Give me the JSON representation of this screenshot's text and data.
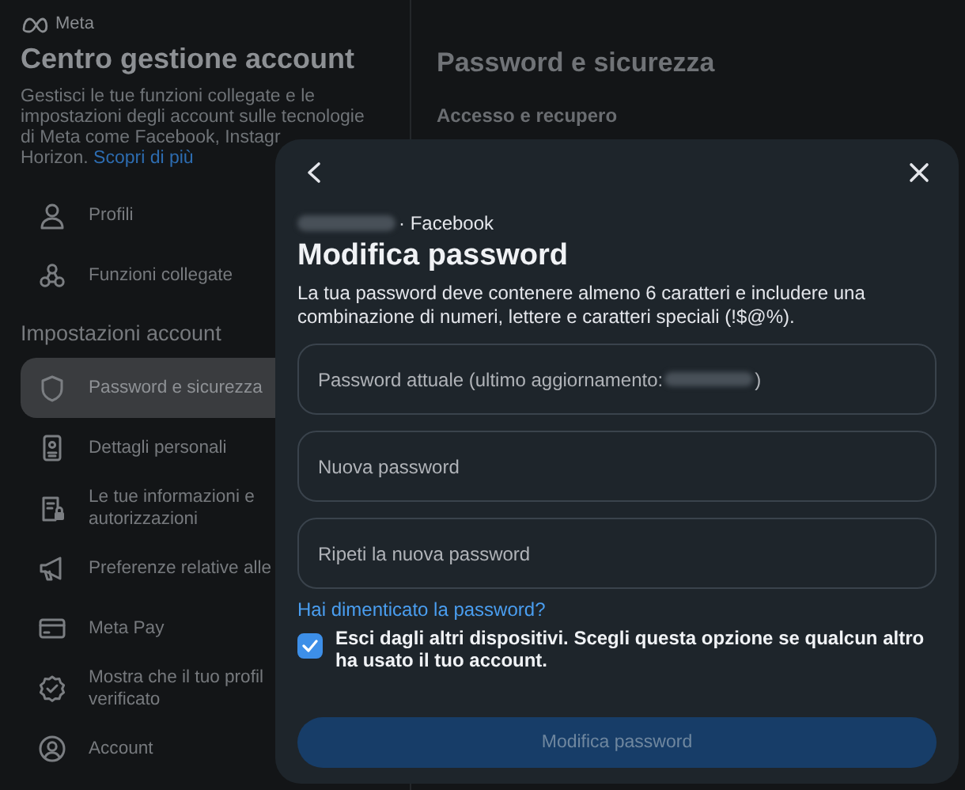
{
  "brand": "Meta",
  "sidebar": {
    "title": "Centro gestione account",
    "description_lines": [
      "Gestisci le tue funzioni collegate e le",
      "impostazioni degli account sulle tecnologie",
      "di Meta come Facebook, Instagr",
      "Horizon."
    ],
    "learn_more": "Scopri di più",
    "items": [
      {
        "kind": "item",
        "label": "Profili",
        "selected": false
      },
      {
        "kind": "item",
        "label": "Funzioni collegate",
        "selected": false
      },
      {
        "kind": "heading",
        "label": "Impostazioni account"
      },
      {
        "kind": "item",
        "label": "Password e sicurezza",
        "selected": true
      },
      {
        "kind": "item",
        "label": "Dettagli personali",
        "selected": false
      },
      {
        "kind": "item",
        "label": "Le tue informazioni e autorizzazioni",
        "selected": false
      },
      {
        "kind": "item",
        "label": "Preferenze relative alle",
        "selected": false
      },
      {
        "kind": "item",
        "label": "Meta Pay",
        "selected": false
      },
      {
        "kind": "item",
        "label": "Mostra che il tuo profil verificato",
        "selected": false
      },
      {
        "kind": "item",
        "label": "Account",
        "selected": false
      }
    ]
  },
  "main": {
    "title": "Password e sicurezza",
    "section": "Accesso e recupero"
  },
  "dialog": {
    "account_suffix": "· Facebook",
    "title": "Modifica password",
    "description": "La tua password deve contenere almeno 6 caratteri e includere una combinazione di numeri, lettere e caratteri speciali (!$@%).",
    "fields": [
      {
        "placeholder": "Password attuale (ultimo aggiornamento:",
        "redacted": true,
        "placeholder_end": ")"
      },
      {
        "placeholder": "Nuova password",
        "redacted": false
      },
      {
        "placeholder": "Ripeti la nuova password",
        "redacted": false
      }
    ],
    "forgot_link": "Hai dimenticato la password?",
    "logout_option": {
      "label": "Esci dagli altri dispositivi. Scegli questa opzione se qualcun altro ha usato il tuo account.",
      "checked": true
    },
    "submit": {
      "label": "Modifica password",
      "disabled": true
    }
  }
}
